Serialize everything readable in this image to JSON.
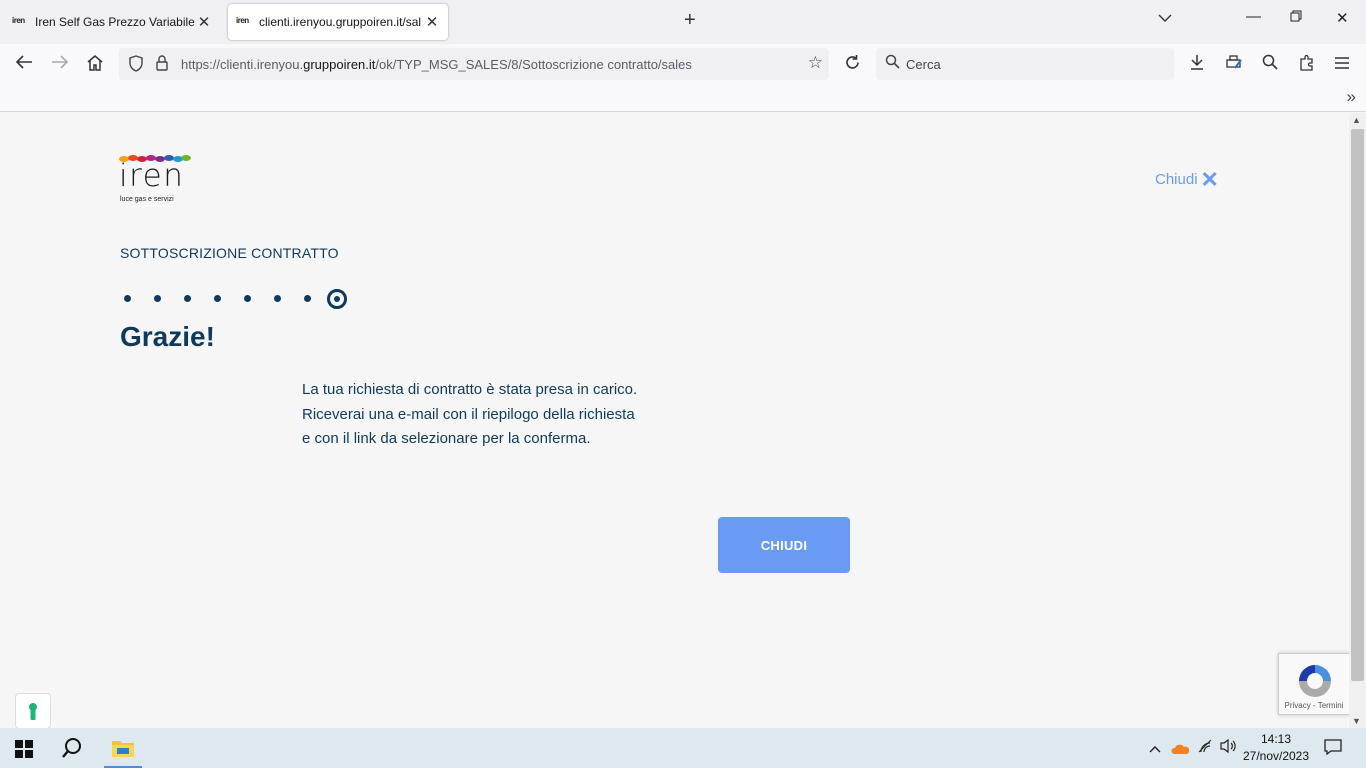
{
  "browser": {
    "tabs": [
      {
        "title": "Iren Self Gas Prezzo Variabile | Ir",
        "active": false,
        "favicon": "iren-logo"
      },
      {
        "title": "clienti.irenyou.gruppoiren.it/sal",
        "active": true,
        "favicon": "iren-logo"
      }
    ],
    "favicon_text": "iren",
    "url": {
      "prefix": "https://clienti.irenyou.",
      "domain": "gruppoiren.it",
      "path": "/ok/TYP_MSG_SALES/8/Sottoscrizione contratto/sales"
    },
    "search_placeholder": "Cerca"
  },
  "page": {
    "logo": {
      "word": "iren",
      "tagline": "luce gas e servizi"
    },
    "close_top_label": "Chiudi",
    "section_title": "SOTTOSCRIZIONE CONTRATTO",
    "steps": {
      "total": 8,
      "current": 8
    },
    "heading": "Grazie!",
    "message_lines": [
      "La tua richiesta di contratto è stata presa in carico.",
      "Riceverai una e-mail con il riepilogo della richiesta",
      "e con il link da selezionare per la conferma."
    ],
    "close_button_label": "CHIUDI",
    "recaptcha_label": "Privacy - Termini"
  },
  "colors": {
    "primary_navy": "#103a5c",
    "accent_blue": "#6a9bf4",
    "background": "#f6f6f6"
  },
  "taskbar": {
    "time": "14:13",
    "date": "27/nov/2023"
  }
}
